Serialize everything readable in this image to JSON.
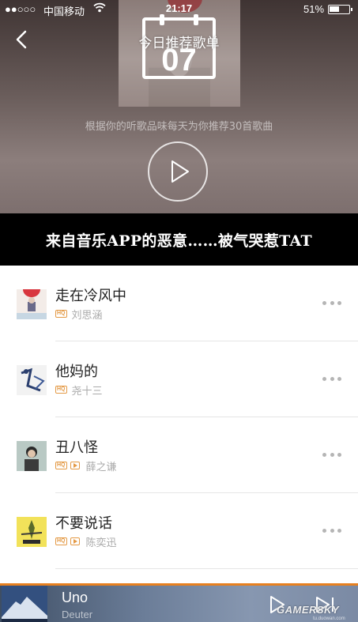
{
  "status_bar": {
    "signal": "●●○○○",
    "carrier": "中国移动",
    "time": "21:17",
    "battery": "51%"
  },
  "header": {
    "title": "今日推荐歌单",
    "calendar_day": "07",
    "subtitle": "根据你的听歌品味每天为你推荐30首歌曲"
  },
  "banner": {
    "text": "来自音乐APP的恶意……被气哭惹TAT"
  },
  "songs": [
    {
      "title": "走在冷风中",
      "artist": "刘思涵",
      "hq_label": "HQ",
      "has_mv": false
    },
    {
      "title": "他妈的",
      "artist": "尧十三",
      "hq_label": "HQ",
      "has_mv": false
    },
    {
      "title": "丑八怪",
      "artist": "薛之谦",
      "hq_label": "HQ",
      "has_mv": true
    },
    {
      "title": "不要说话",
      "artist": "陈奕迅",
      "hq_label": "HQ",
      "has_mv": true
    }
  ],
  "player": {
    "title": "Uno",
    "artist": "Deuter"
  },
  "watermark": {
    "brand": "GAMERSKY",
    "sub": "tu.duowan.com"
  },
  "colors": {
    "accent": "#e7801f",
    "badge": "#e49a46",
    "banner_bg": "#000000"
  }
}
